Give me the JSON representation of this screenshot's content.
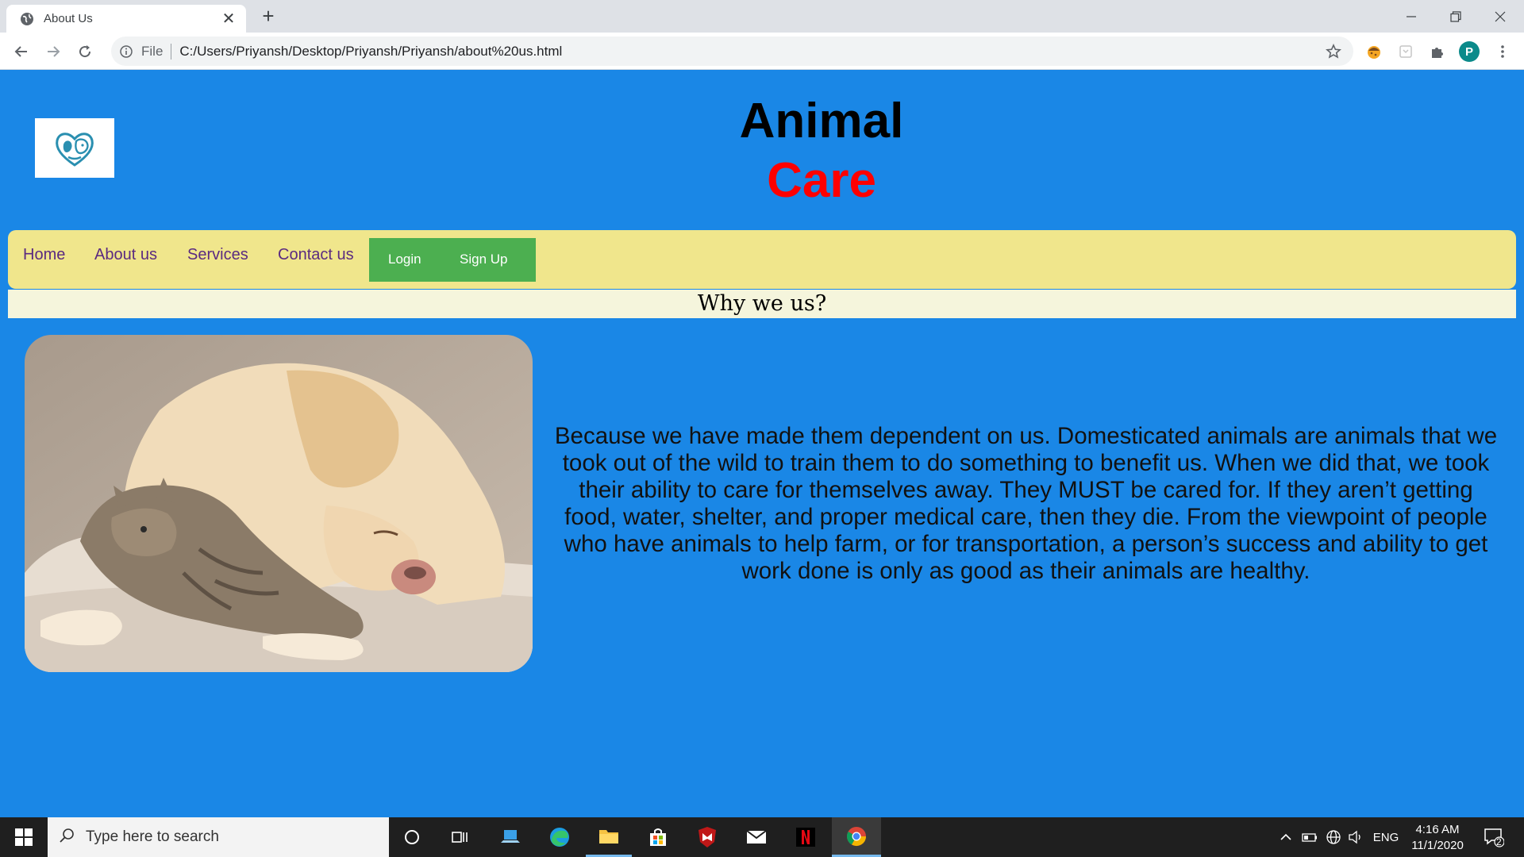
{
  "browser": {
    "tab_title": "About Us",
    "tab_close": "✕",
    "new_tab": "+",
    "address_scheme": "File",
    "address_url": "C:/Users/Priyansh/Desktop/Priyansh/Priyansh/about%20us.html",
    "profile_initial": "P"
  },
  "site": {
    "title_line1": "Animal",
    "title_line2": "Care",
    "colors": {
      "background": "#1a87e6",
      "navbar": "#f0e68c",
      "auth": "#4caf50",
      "accent": "#ff0000"
    }
  },
  "nav": {
    "items": [
      {
        "label": "Home"
      },
      {
        "label": "About us"
      },
      {
        "label": "Services"
      },
      {
        "label": "Contact us"
      }
    ],
    "login_label": "Login",
    "signup_label": "Sign Up"
  },
  "section": {
    "heading": "Why we us?",
    "body": "Because we have made them dependent on us. Domesticated animals are animals that we took out of the wild to train them to do something to benefit us. When we did that, we took their ability to care for themselves away. They MUST be cared for. If they aren’t getting food, water, shelter, and proper medical care, then they die. From the viewpoint of people who have animals to help farm, or for transportation, a person’s success and ability to get work done is only as good as their animals are healthy."
  },
  "taskbar": {
    "search_placeholder": "Type here to search",
    "language": "ENG",
    "time": "4:16 AM",
    "date": "11/1/2020",
    "notification_count": "2"
  }
}
